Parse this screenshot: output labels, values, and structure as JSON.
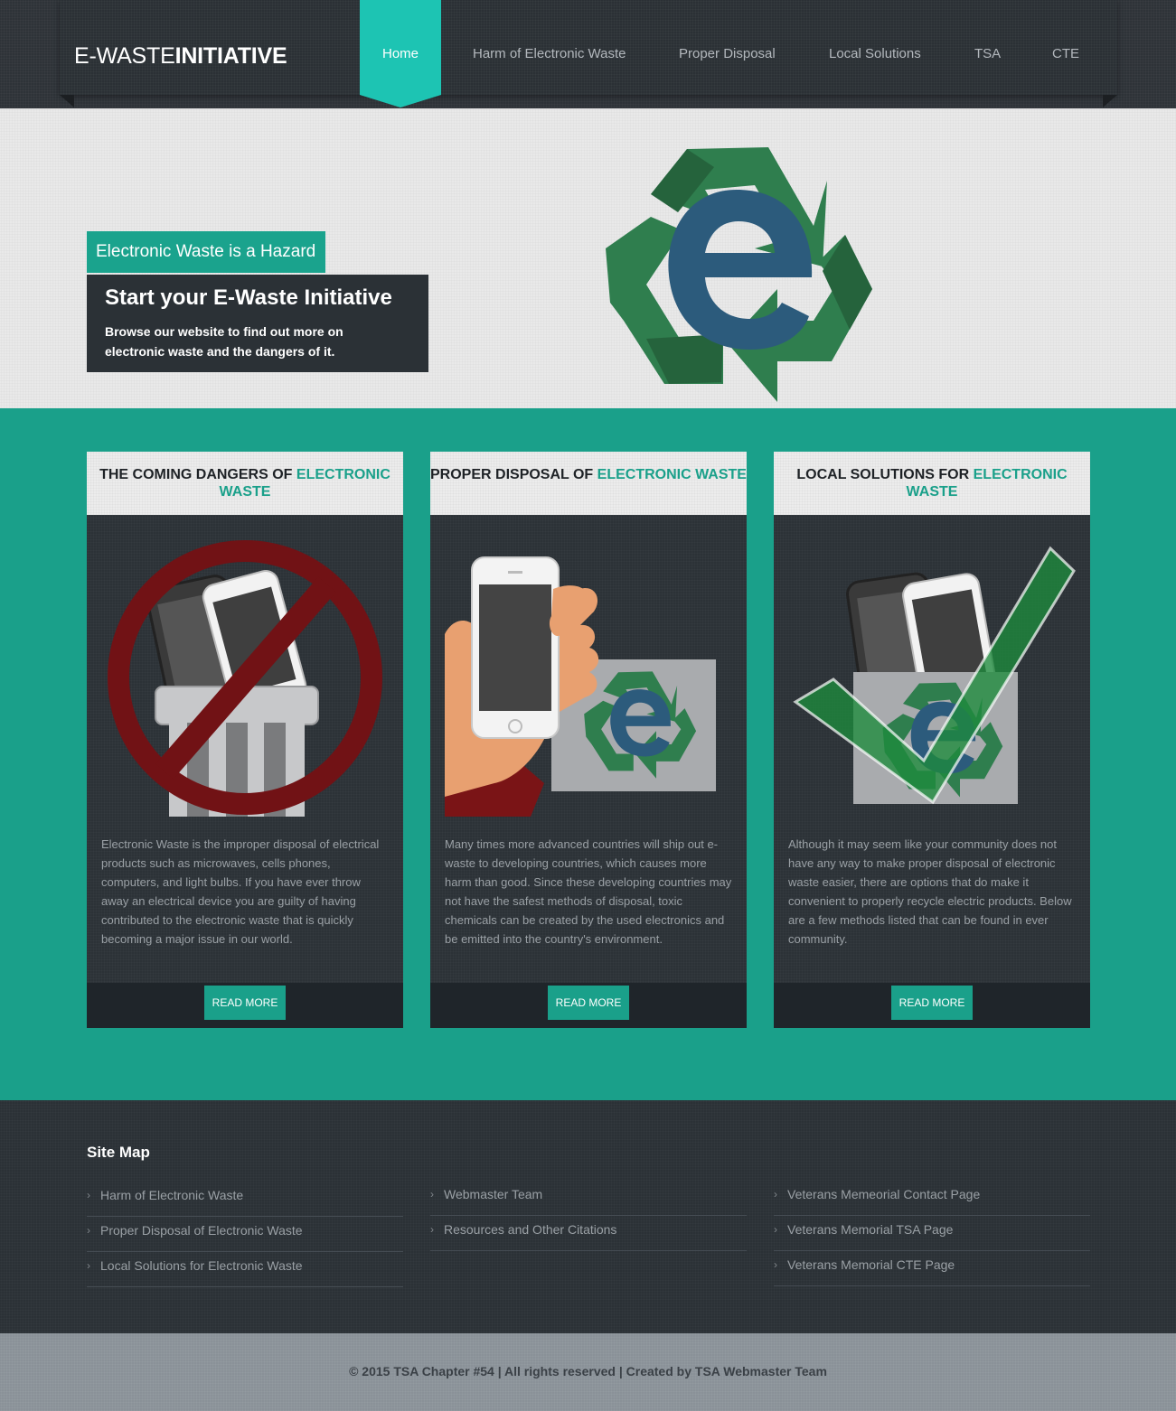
{
  "site": {
    "logo_light": "E-WASTE",
    "logo_bold": "INITIATIVE"
  },
  "nav": {
    "items": [
      {
        "label": "Home",
        "active": true
      },
      {
        "label": "Harm of Electronic Waste",
        "active": false
      },
      {
        "label": "Proper Disposal",
        "active": false
      },
      {
        "label": "Local Solutions",
        "active": false
      },
      {
        "label": "TSA",
        "active": false
      },
      {
        "label": "CTE",
        "active": false
      }
    ]
  },
  "hero": {
    "badge": "Electronic Waste is a Hazard",
    "title": "Start your E-Waste Initiative",
    "text": "Browse our website to find out more on electronic waste and the dangers of it."
  },
  "cards": [
    {
      "heading_dark": "THE COMING DANGERS OF",
      "heading_accent": "ELECTRONIC WASTE",
      "image_icon": "no-phones-in-trash-icon",
      "text": "Electronic Waste is the improper disposal of electrical products such as microwaves, cells phones, computers, and light bulbs. If you have ever throw away an electrical device you are guilty of having contributed to the electronic waste that is quickly becoming a major issue in our world.",
      "button": "READ MORE"
    },
    {
      "heading_dark": "PROPER DISPOSAL OF",
      "heading_accent": "ELECTRONIC WASTE",
      "image_icon": "phone-to-recycle-bin-icon",
      "text": "Many times more advanced countries will ship out e-waste to developing countries, which causes more harm than good. Since these developing countries may not have the safest methods of disposal, toxic chemicals can be created by the used electronics and be emitted into the country's environment.",
      "button": "READ MORE"
    },
    {
      "heading_dark": "LOCAL SOLUTIONS FOR",
      "heading_accent": "ELECTRONIC WASTE",
      "image_icon": "phones-recycled-checkmark-icon",
      "text": "Although it may seem like your community does not have any way to make proper disposal of electronic waste easier, there are options that do make it convenient to properly recycle electric products. Below are a few methods listed that can be found in ever community.",
      "button": "READ MORE"
    }
  ],
  "footer": {
    "sitemap_title": "Site Map",
    "columns": [
      [
        "Harm of Electronic Waste",
        "Proper Disposal of Electronic Waste",
        "Local Solutions for Electronic Waste"
      ],
      [
        "Webmaster Team",
        "Resources and Other Citations"
      ],
      [
        "Veterans Memeorial Contact Page",
        "Veterans Memorial TSA Page",
        "Veterans Memorial CTE Page"
      ]
    ],
    "copyright": "© 2015 TSA Chapter #54 | All rights reserved | Created by TSA Webmaster Team"
  },
  "colors": {
    "accent": "#1aa08a",
    "nav_active": "#1dc4b3",
    "dark": "#2b3136"
  }
}
